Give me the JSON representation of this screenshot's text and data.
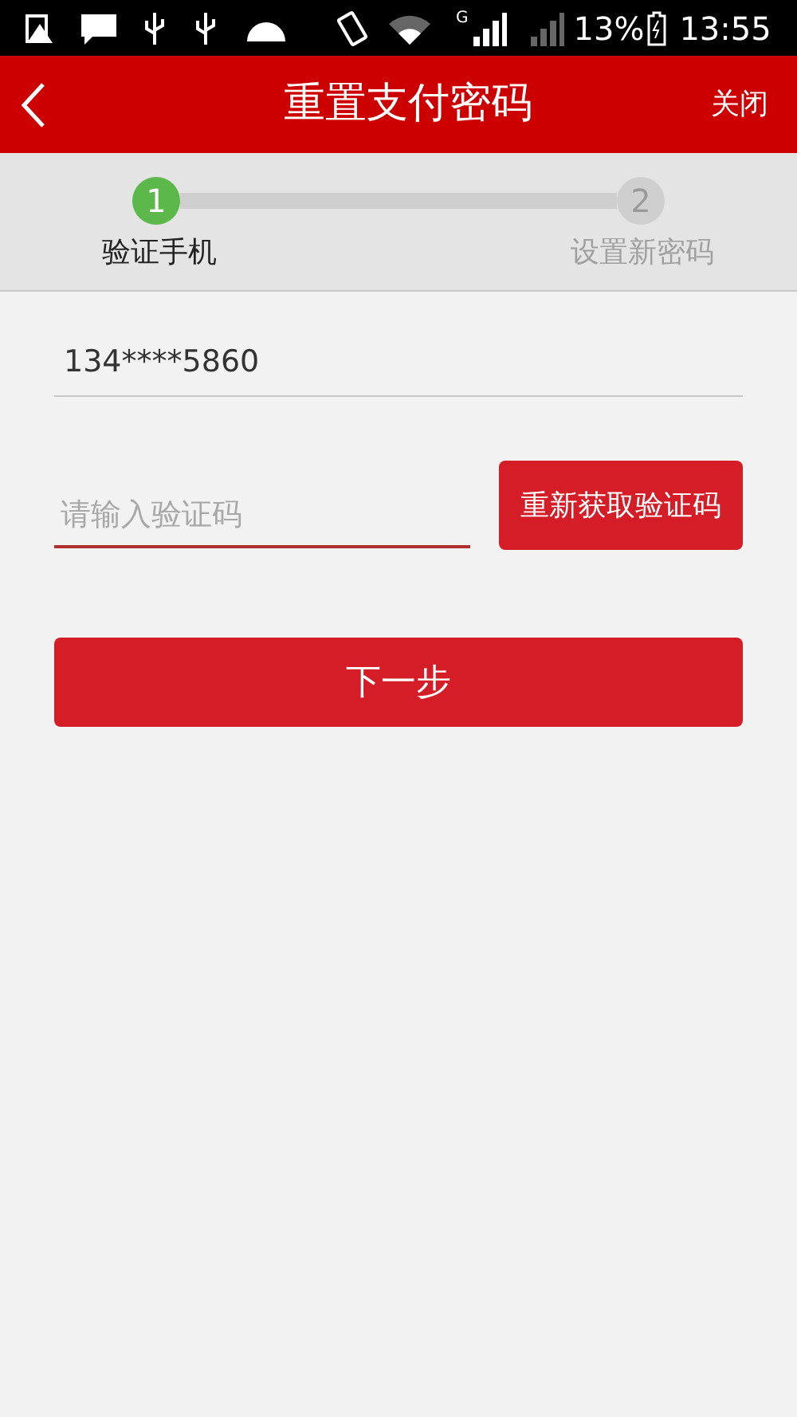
{
  "status_bar": {
    "network_type": "G",
    "battery": "13%",
    "time": "13:55"
  },
  "header": {
    "title": "重置支付密码",
    "close": "关闭"
  },
  "steps": [
    {
      "number": "1",
      "label": "验证手机",
      "selected": true
    },
    {
      "number": "2",
      "label": "设置新密码",
      "selected": false
    }
  ],
  "phone": {
    "value": "134****5860"
  },
  "code": {
    "placeholder": "请输入验证码",
    "resend": "重新获取验证码"
  },
  "next_button": "下一步"
}
